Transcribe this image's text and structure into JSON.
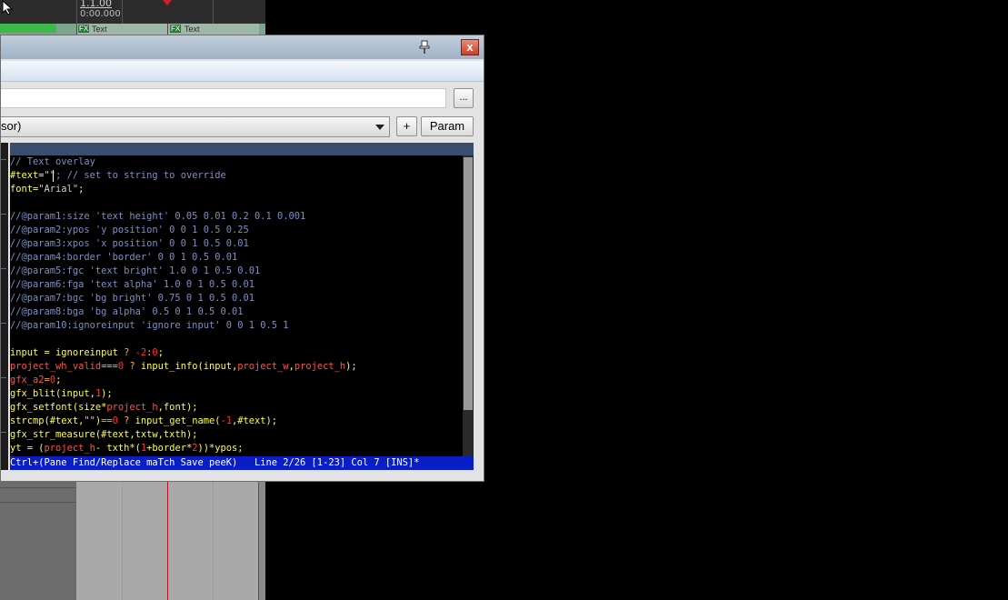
{
  "daw": {
    "position_label": "1.1.00",
    "time_label": "0:00.000",
    "clips": [
      {
        "fx": "FX",
        "label": "Text"
      },
      {
        "fx": "FX",
        "label": "Text"
      }
    ]
  },
  "editor": {
    "close_label": "x",
    "browse_label": "...",
    "preset_combo_value": "sor)",
    "plus_label": "+",
    "param_label": "Param",
    "code_lines": [
      [
        {
          "t": "// Text overlay",
          "c": "c-com"
        }
      ],
      [
        {
          "t": "#text=",
          "c": "c-fn"
        },
        {
          "t": "\"\"",
          "c": "c-str"
        },
        {
          "t": "; // set to string to override",
          "c": "c-com"
        }
      ],
      [
        {
          "t": "font=",
          "c": "c-fn"
        },
        {
          "t": "\"Arial\"",
          "c": "c-str"
        },
        {
          "t": ";",
          "c": "c-fn"
        }
      ],
      [
        {
          "t": "",
          "c": "c-def"
        }
      ],
      [
        {
          "t": "//@param1:size 'text height' 0.05 0.01 0.2 0.1 0.001",
          "c": "c-com"
        }
      ],
      [
        {
          "t": "//@param2:ypos 'y position' 0 0 1 0.5 0.25",
          "c": "c-com"
        }
      ],
      [
        {
          "t": "//@param3:xpos 'x position' 0 0 1 0.5 0.01",
          "c": "c-com"
        }
      ],
      [
        {
          "t": "//@param4:border 'border' 0 0 1 0.5 0.01",
          "c": "c-com"
        }
      ],
      [
        {
          "t": "//@param5:fgc 'text bright' 1.0 0 1 0.5 0.01",
          "c": "c-com"
        }
      ],
      [
        {
          "t": "//@param6:fga 'text alpha' 1.0 0 1 0.5 0.01",
          "c": "c-com"
        }
      ],
      [
        {
          "t": "//@param7:bgc 'bg bright' 0.75 0 1 0.5 0.01",
          "c": "c-com"
        }
      ],
      [
        {
          "t": "//@param8:bga 'bg alpha' 0.5 0 1 0.5 0.01",
          "c": "c-com"
        }
      ],
      [
        {
          "t": "//@param10:ignoreinput 'ignore input' 0 0 1 0.5 1",
          "c": "c-com"
        }
      ],
      [
        {
          "t": "",
          "c": "c-def"
        }
      ],
      [
        {
          "t": "input = ignoreinput ",
          "c": "c-fn"
        },
        {
          "t": "? ",
          "c": "c-op"
        },
        {
          "t": "-2",
          "c": "c-num"
        },
        {
          "t": ":",
          "c": "c-op"
        },
        {
          "t": "0",
          "c": "c-num"
        },
        {
          "t": ";",
          "c": "c-fn"
        }
      ],
      [
        {
          "t": "project_wh_valid",
          "c": "c-var"
        },
        {
          "t": "===",
          "c": "c-op"
        },
        {
          "t": "0 ",
          "c": "c-num"
        },
        {
          "t": "? ",
          "c": "c-op"
        },
        {
          "t": "input_info(input,",
          "c": "c-fn"
        },
        {
          "t": "project_w",
          "c": "c-var"
        },
        {
          "t": ",",
          "c": "c-fn"
        },
        {
          "t": "project_h",
          "c": "c-var"
        },
        {
          "t": ");",
          "c": "c-fn"
        }
      ],
      [
        {
          "t": "gfx_a2",
          "c": "c-var"
        },
        {
          "t": "=",
          "c": "c-op"
        },
        {
          "t": "0",
          "c": "c-num"
        },
        {
          "t": ";",
          "c": "c-fn"
        }
      ],
      [
        {
          "t": "gfx_blit(input,",
          "c": "c-fn"
        },
        {
          "t": "1",
          "c": "c-num"
        },
        {
          "t": ");",
          "c": "c-fn"
        }
      ],
      [
        {
          "t": "gfx_setfont(size*",
          "c": "c-fn"
        },
        {
          "t": "project_h",
          "c": "c-var"
        },
        {
          "t": ",font);",
          "c": "c-fn"
        }
      ],
      [
        {
          "t": "strcmp(#text,",
          "c": "c-fn"
        },
        {
          "t": "\"\"",
          "c": "c-str"
        },
        {
          "t": ")",
          "c": "c-fn"
        },
        {
          "t": "==",
          "c": "c-op"
        },
        {
          "t": "0 ",
          "c": "c-num"
        },
        {
          "t": "? ",
          "c": "c-op"
        },
        {
          "t": "input_get_name(",
          "c": "c-fn"
        },
        {
          "t": "-1",
          "c": "c-num"
        },
        {
          "t": ",#text);",
          "c": "c-fn"
        }
      ],
      [
        {
          "t": "gfx_str_measure(#text,txtw,txth);",
          "c": "c-fn"
        }
      ],
      [
        {
          "t": "yt = (",
          "c": "c-fn"
        },
        {
          "t": "project_h",
          "c": "c-var"
        },
        {
          "t": "- txth*(",
          "c": "c-fn"
        },
        {
          "t": "1",
          "c": "c-num"
        },
        {
          "t": "+border*",
          "c": "c-fn"
        },
        {
          "t": "2",
          "c": "c-num"
        },
        {
          "t": "))*ypos;",
          "c": "c-fn"
        }
      ]
    ],
    "status_line": "Ctrl+(Pane Find/Replace maTch Save peeK)   Line 2/26 [1-23] Col 7 [INS]*"
  }
}
